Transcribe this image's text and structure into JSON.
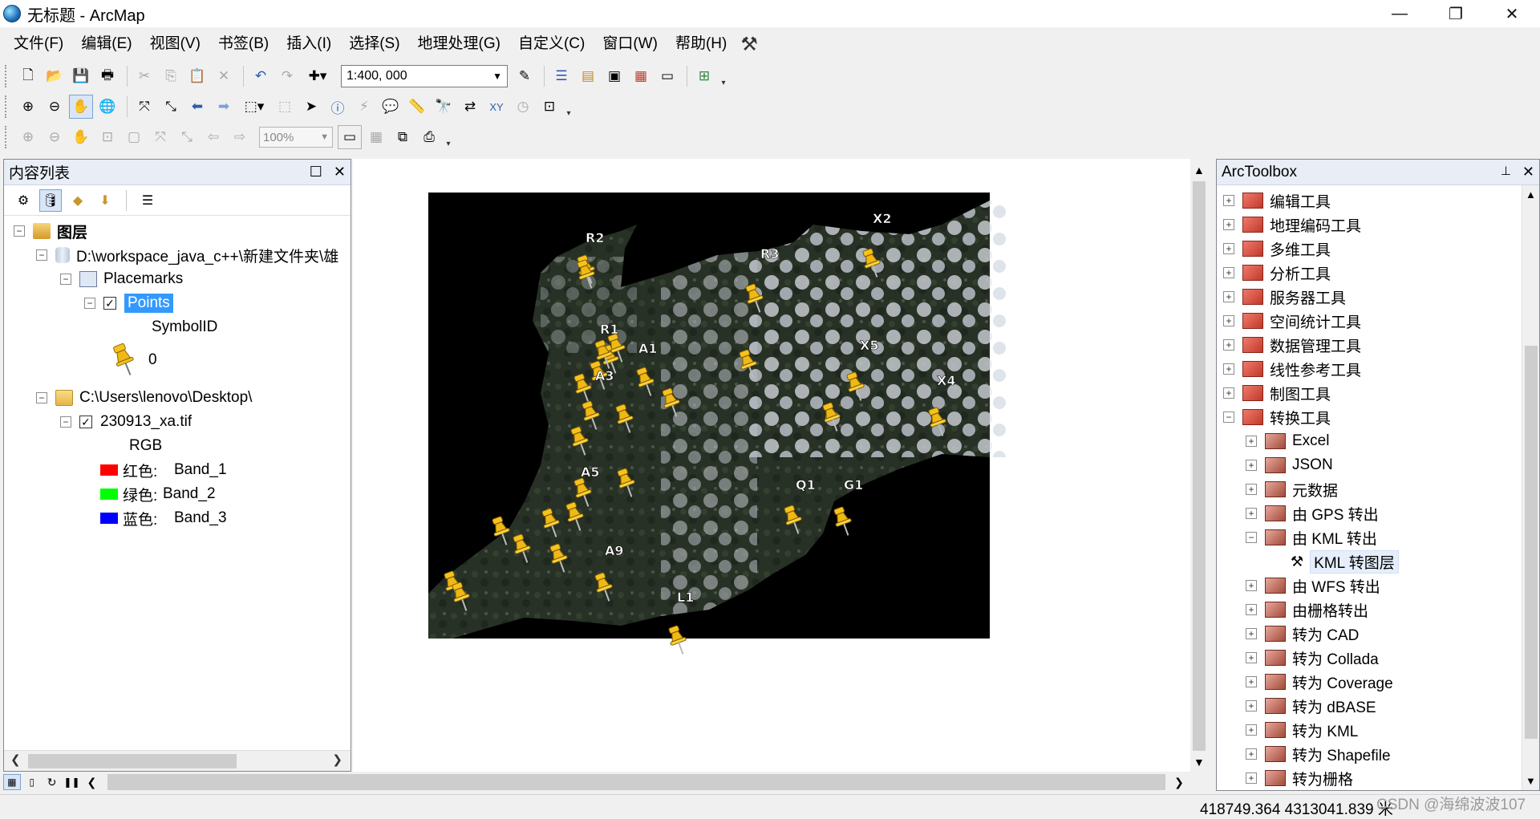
{
  "window": {
    "title": "无标题 - ArcMap",
    "minimize": "—",
    "restore": "❐",
    "close": "✕"
  },
  "menu": [
    "文件(F)",
    "编辑(E)",
    "视图(V)",
    "书签(B)",
    "插入(I)",
    "选择(S)",
    "地理处理(G)",
    "自定义(C)",
    "窗口(W)",
    "帮助(H)"
  ],
  "standard_toolbar": {
    "scale": "1:400, 000"
  },
  "layout_toolbar": {
    "zoom": "100%"
  },
  "toc": {
    "title": "内容列表",
    "pin": "☐",
    "close": "✕",
    "layers_label": "图层",
    "gdb_path": "D:\\workspace_java_c++\\新建文件夹\\雄",
    "placemarks": "Placemarks",
    "points": "Points",
    "symbol_field": "SymbolID",
    "symbol_value": "0",
    "folder_path": "C:\\Users\\lenovo\\Desktop\\",
    "raster_name": "230913_xa.tif",
    "rgb": "RGB",
    "bands": [
      {
        "label": "红色:",
        "band": "Band_1",
        "color": "#ff0000"
      },
      {
        "label": "绿色:",
        "band": "Band_2",
        "color": "#00ff00"
      },
      {
        "label": "蓝色:",
        "band": "Band_3",
        "color": "#0000ff"
      }
    ]
  },
  "map": {
    "labels": [
      "R2",
      "R3",
      "X2",
      "R1",
      "A1",
      "X5",
      "A3",
      "X4",
      "A5",
      "Q1",
      "G1",
      "A9",
      "L1"
    ]
  },
  "toolbox": {
    "title": "ArcToolbox",
    "pin": "📌",
    "close": "✕",
    "items": [
      "编辑工具",
      "地理编码工具",
      "多维工具",
      "分析工具",
      "服务器工具",
      "空间统计工具",
      "数据管理工具",
      "线性参考工具",
      "制图工具",
      "转换工具"
    ],
    "conversion_children": [
      "Excel",
      "JSON",
      "元数据",
      "由 GPS 转出",
      "由 KML 转出",
      "由 WFS 转出",
      "由栅格转出",
      "转为 CAD",
      "转为 Collada",
      "转为 Coverage",
      "转为 dBASE",
      "转为 KML",
      "转为 Shapefile",
      "转为栅格"
    ],
    "kml_tool": "KML 转图层"
  },
  "status": {
    "coordinates": "418749.364  4313041.839 米",
    "watermark": "CSDN @海绵波波107"
  },
  "colors": {
    "selection": "#3399ff",
    "panel_header": "#e8edf6",
    "toolbox_red": "#d43a2f"
  }
}
